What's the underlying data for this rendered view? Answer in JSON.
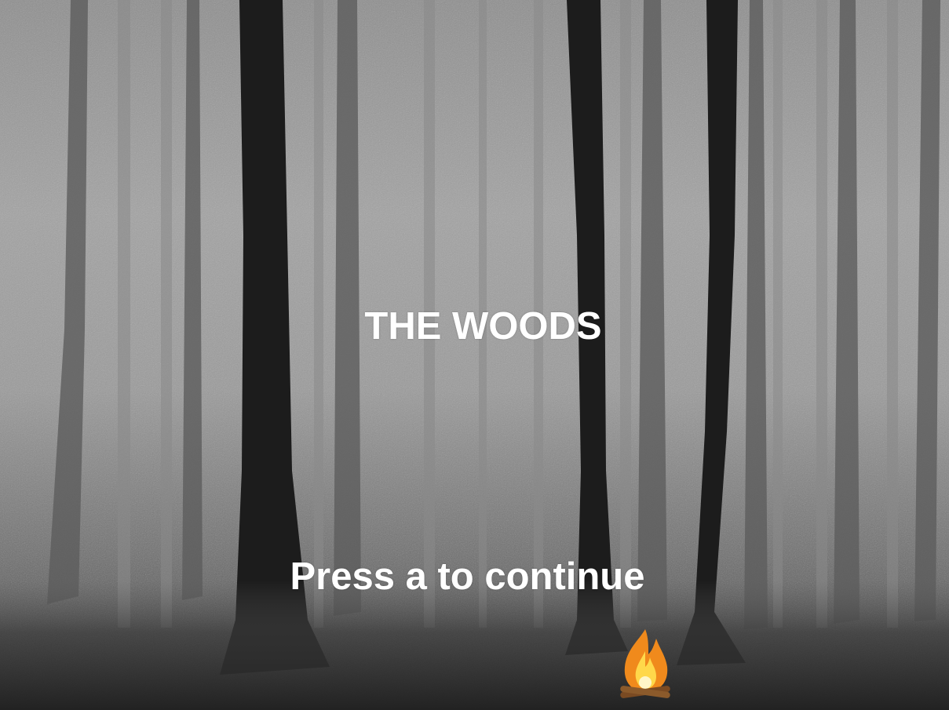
{
  "game": {
    "title": "THE WOODS",
    "prompt": "Press a to continue"
  },
  "icons": {
    "campfire": "campfire-icon"
  },
  "colors": {
    "text": "#ffffff",
    "fog": "#a2a2a2",
    "tree": "#1c1c1c",
    "fire_outer": "#f08a1c",
    "fire_inner": "#ffd84a"
  }
}
